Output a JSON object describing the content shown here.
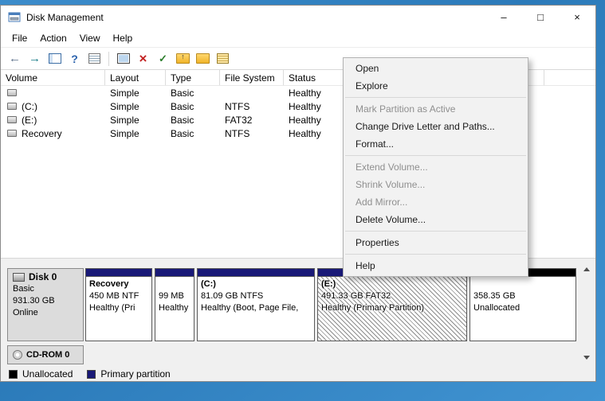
{
  "window": {
    "title": "Disk Management",
    "minimize": "–",
    "maximize": "□",
    "close": "×"
  },
  "menubar": {
    "items": [
      "File",
      "Action",
      "View",
      "Help"
    ]
  },
  "toolbar": {
    "icons": [
      "back",
      "forward",
      "console-tree",
      "help",
      "export-list",
      "screen",
      "delete",
      "check",
      "folder-up",
      "folder",
      "legend-box"
    ]
  },
  "volume_list": {
    "columns": [
      "Volume",
      "Layout",
      "Type",
      "File System",
      "Status"
    ],
    "rows": [
      {
        "volume": "",
        "layout": "Simple",
        "type": "Basic",
        "file_system": "",
        "status": "Healthy"
      },
      {
        "volume": "(C:)",
        "layout": "Simple",
        "type": "Basic",
        "file_system": "NTFS",
        "status": "Healthy"
      },
      {
        "volume": "(E:)",
        "layout": "Simple",
        "type": "Basic",
        "file_system": "FAT32",
        "status": "Healthy"
      },
      {
        "volume": "Recovery",
        "layout": "Simple",
        "type": "Basic",
        "file_system": "NTFS",
        "status": "Healthy"
      }
    ]
  },
  "context_menu": {
    "items": [
      {
        "label": "Open",
        "enabled": true
      },
      {
        "label": "Explore",
        "enabled": true
      },
      {
        "label": "Mark Partition as Active",
        "enabled": false
      },
      {
        "label": "Change Drive Letter and Paths...",
        "enabled": true
      },
      {
        "label": "Format...",
        "enabled": true
      },
      {
        "label": "Extend Volume...",
        "enabled": false
      },
      {
        "label": "Shrink Volume...",
        "enabled": false
      },
      {
        "label": "Add Mirror...",
        "enabled": false
      },
      {
        "label": "Delete Volume...",
        "enabled": true
      },
      {
        "label": "Properties",
        "enabled": true
      },
      {
        "label": "Help",
        "enabled": true
      }
    ]
  },
  "disks": {
    "disk0": {
      "name": "Disk 0",
      "type": "Basic",
      "size": "931.30 GB",
      "status": "Online",
      "partitions": [
        {
          "name": "Recovery",
          "size_line": "450 MB NTF",
          "status_line": "Healthy (Pri",
          "selected": false
        },
        {
          "name": "",
          "size_line": "99 MB",
          "status_line": "Healthy",
          "selected": false
        },
        {
          "name": "(C:)",
          "size_line": "81.09 GB NTFS",
          "status_line": "Healthy (Boot, Page File,",
          "selected": false
        },
        {
          "name": "(E:)",
          "size_line": "491.33 GB FAT32",
          "status_line": "Healthy (Primary Partition)",
          "selected": true
        },
        {
          "name": "",
          "size_line": "358.35 GB",
          "status_line": "Unallocated",
          "selected": false,
          "unallocated": true
        }
      ]
    },
    "cdrom": {
      "name": "CD-ROM 0"
    }
  },
  "legend": {
    "items": [
      {
        "label": "Unallocated",
        "color": "#000000"
      },
      {
        "label": "Primary partition",
        "color": "#191977"
      }
    ]
  }
}
